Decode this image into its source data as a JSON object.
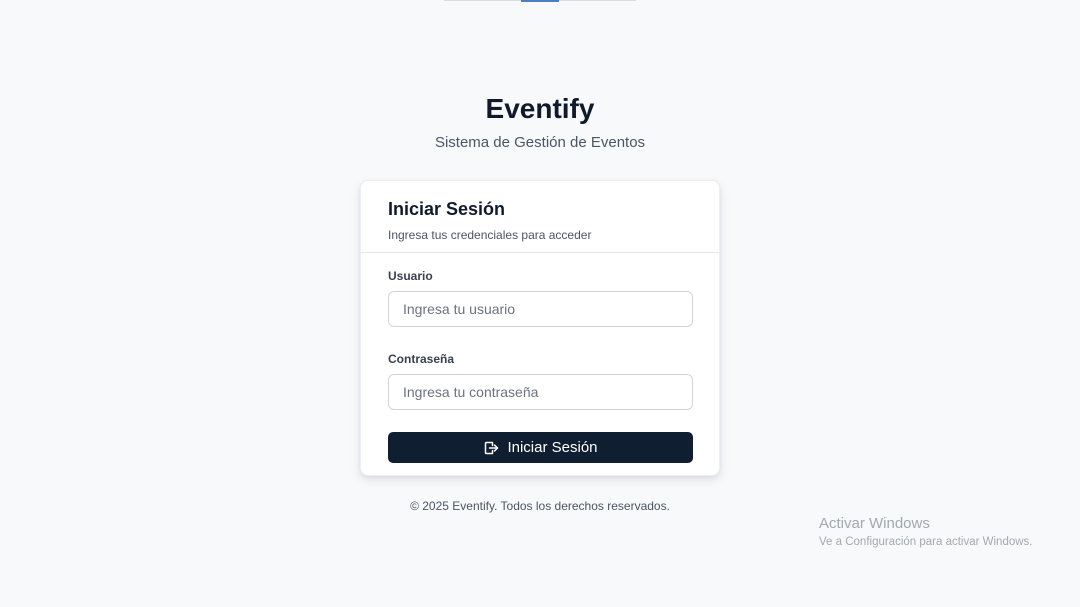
{
  "brand": {
    "title": "Eventify",
    "subtitle": "Sistema de Gestión de Eventos"
  },
  "login_card": {
    "title": "Iniciar Sesión",
    "description": "Ingresa tus credenciales para acceder",
    "username": {
      "label": "Usuario",
      "placeholder": "Ingresa tu usuario",
      "value": ""
    },
    "password": {
      "label": "Contraseña",
      "placeholder": "Ingresa tu contraseña",
      "value": ""
    },
    "submit": {
      "label": "Iniciar Sesión",
      "icon": "login-icon"
    }
  },
  "footer": {
    "text": "© 2025 Eventify. Todos los derechos reservados."
  },
  "os_watermark": {
    "title": "Activar Windows",
    "subtitle": "Ve a Configuración para activar Windows."
  },
  "colors": {
    "background": "#f8f9fb",
    "primary_button": "#0f1e30",
    "text_dark": "#0f1b2d",
    "text_muted": "#4b5563",
    "accent_strip": "#4a7fc1"
  }
}
